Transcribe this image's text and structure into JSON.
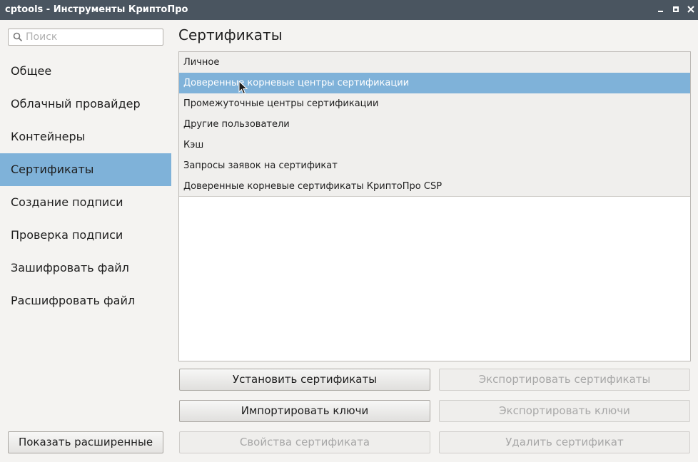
{
  "window": {
    "title": "cptools - Инструменты КриптоПро"
  },
  "sidebar": {
    "search_placeholder": "Поиск",
    "items": [
      {
        "label": "Общее"
      },
      {
        "label": "Облачный провайдер"
      },
      {
        "label": "Контейнеры"
      },
      {
        "label": "Сертификаты",
        "active": true
      },
      {
        "label": "Создание подписи"
      },
      {
        "label": "Проверка подписи"
      },
      {
        "label": "Зашифровать файл"
      },
      {
        "label": "Расшифровать файл"
      }
    ],
    "show_advanced_label": "Показать расширенные"
  },
  "main": {
    "title": "Сертификаты",
    "stores": [
      {
        "label": "Личное"
      },
      {
        "label": "Доверенные корневые центры сертификации",
        "selected": true
      },
      {
        "label": "Промежуточные центры сертификации"
      },
      {
        "label": "Другие пользователи"
      },
      {
        "label": "Кэш"
      },
      {
        "label": "Запросы заявок на сертификат"
      },
      {
        "label": "Доверенные корневые сертификаты КриптоПро CSP"
      }
    ],
    "buttons": {
      "install_certificates": "Установить сертификаты",
      "export_certificates": "Экспортировать сертификаты",
      "import_keys": "Импортировать ключи",
      "export_keys": "Экспортировать ключи",
      "certificate_properties": "Свойства сертификата",
      "delete_certificate": "Удалить сертификат"
    }
  },
  "colors": {
    "titlebar": "#4a5560",
    "selection": "#7fb2d9",
    "background": "#f4f3f1"
  }
}
